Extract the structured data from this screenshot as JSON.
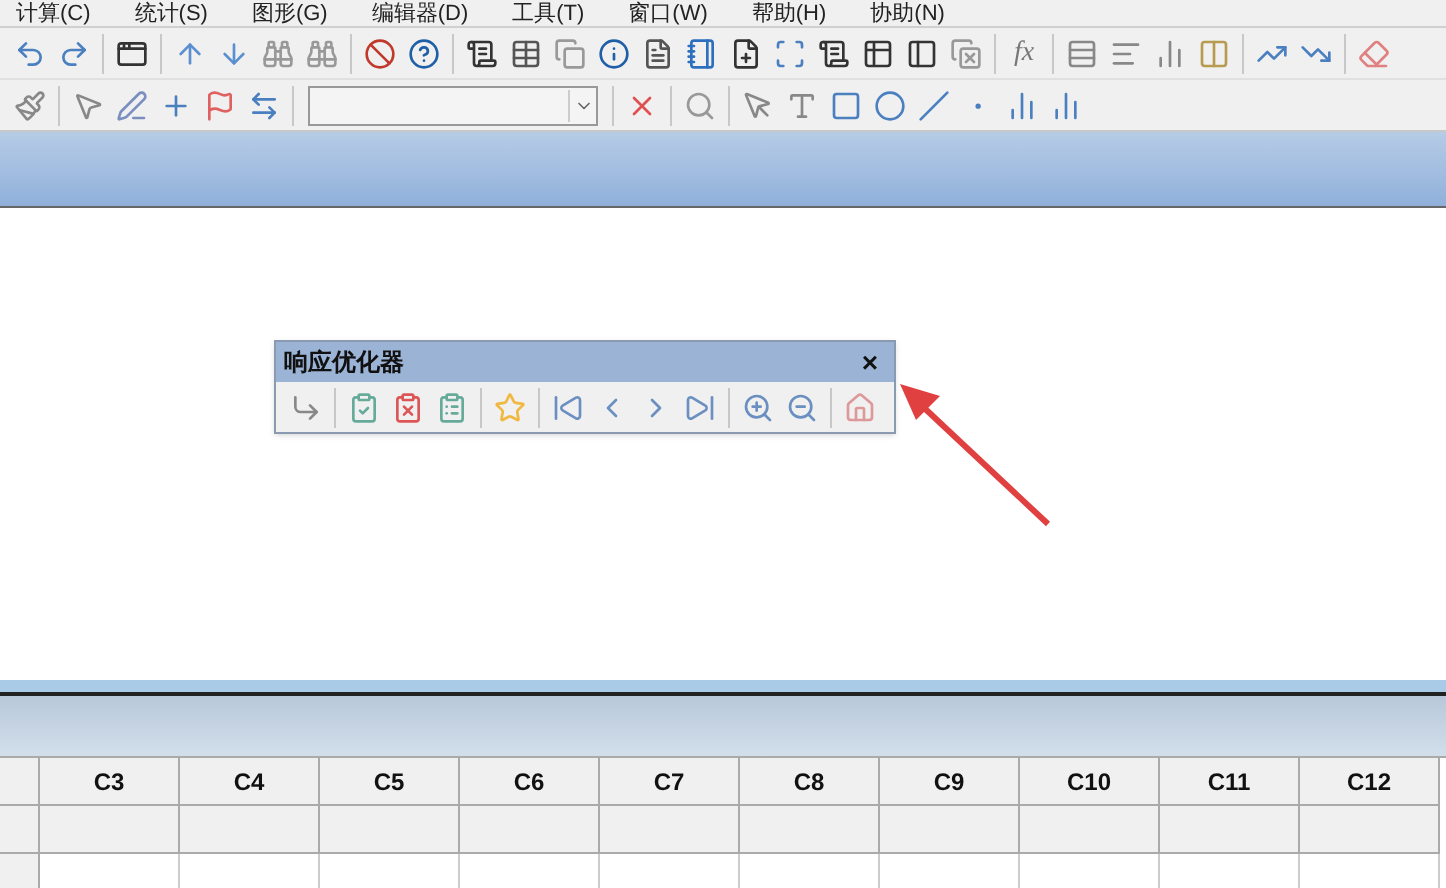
{
  "menu_bar": [
    "计算(C)",
    "统计(S)",
    "图形(G)",
    "编辑器(D)",
    "工具(T)",
    "窗口(W)",
    "帮助(H)",
    "协助(N)"
  ],
  "toolbar": {
    "formula_label": "fx"
  },
  "response_optimizer": {
    "title": "响应优化器",
    "close": "×"
  },
  "worksheet": {
    "columns": [
      "C3",
      "C4",
      "C5",
      "C6",
      "C7",
      "C8",
      "C9",
      "C10",
      "C11",
      "C12"
    ]
  }
}
